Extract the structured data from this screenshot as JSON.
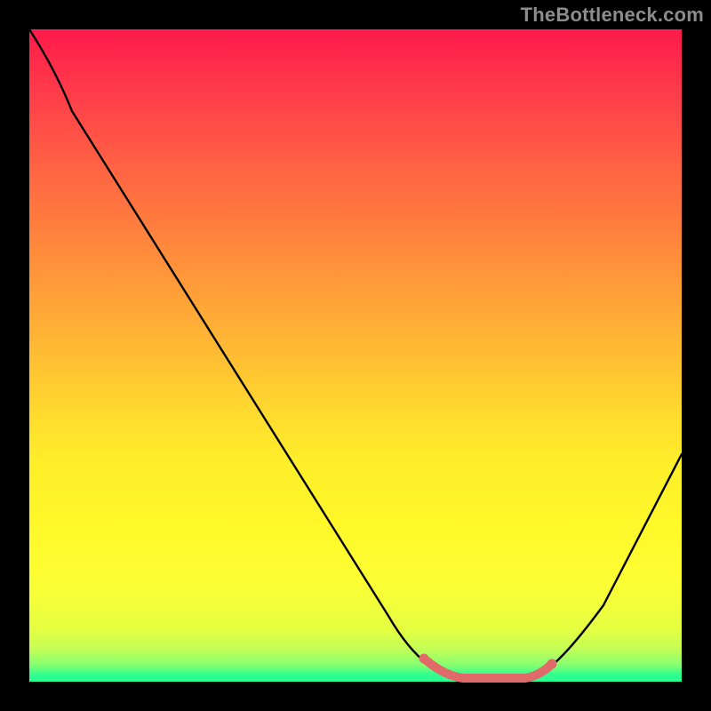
{
  "watermark": "TheBottleneck.com",
  "chart_data": {
    "type": "line",
    "title": "",
    "xlabel": "",
    "ylabel": "",
    "xlim": [
      0,
      1
    ],
    "ylim": [
      0,
      1
    ],
    "grid": false,
    "legend": false,
    "series": [
      {
        "name": "curve",
        "color": "#000000",
        "x": [
          0.0,
          0.055,
          0.11,
          0.165,
          0.22,
          0.275,
          0.33,
          0.385,
          0.44,
          0.495,
          0.55,
          0.59,
          0.62,
          0.65,
          0.69,
          0.73,
          0.77,
          0.8,
          0.84,
          0.88,
          0.92,
          0.96,
          1.0
        ],
        "y": [
          1.0,
          0.93,
          0.85,
          0.76,
          0.67,
          0.575,
          0.48,
          0.385,
          0.29,
          0.195,
          0.105,
          0.055,
          0.028,
          0.012,
          0.004,
          0.004,
          0.01,
          0.025,
          0.065,
          0.125,
          0.195,
          0.27,
          0.35
        ]
      },
      {
        "name": "bottom-marker",
        "color": "#e36a6a",
        "x": [
          0.605,
          0.635,
          0.665,
          0.695,
          0.725,
          0.755,
          0.78
        ],
        "y": [
          0.035,
          0.018,
          0.008,
          0.004,
          0.005,
          0.009,
          0.018
        ]
      }
    ]
  },
  "gradient_stops": [
    {
      "pos": 0.0,
      "color": "#ff1a4b"
    },
    {
      "pos": 0.5,
      "color": "#ffbd33"
    },
    {
      "pos": 0.85,
      "color": "#fcff34"
    },
    {
      "pos": 1.0,
      "color": "#2dff93"
    }
  ]
}
